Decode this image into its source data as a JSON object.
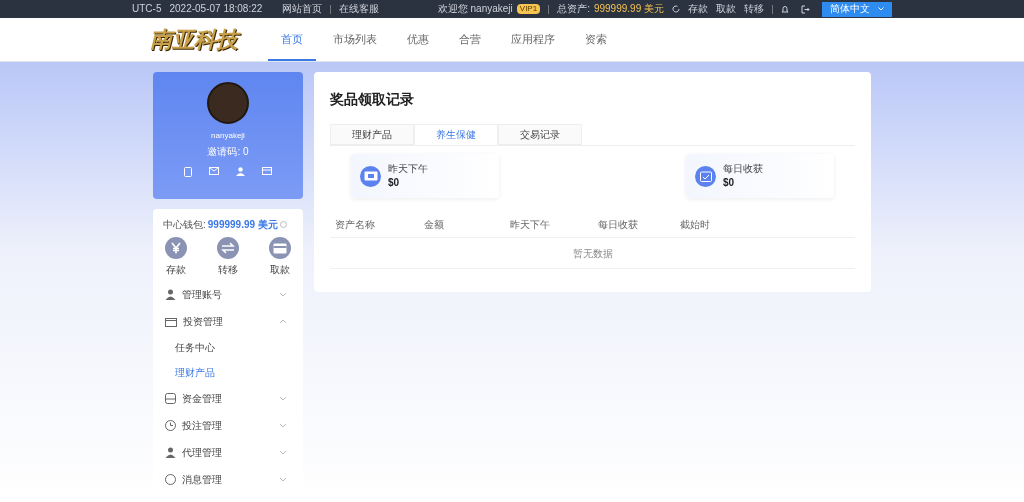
{
  "top_bar": {
    "timezone": "UTC-5",
    "datetime": "2022-05-07 18:08:22",
    "links": [
      "网站首页",
      "在线客服"
    ],
    "welcome": "欢迎您 nanyakeji",
    "vip": "VIP1",
    "assets_label": "总资产:",
    "assets_value": "999999.99 美元",
    "actions": [
      "存款",
      "取款",
      "转移"
    ],
    "language": "简体中文"
  },
  "header": {
    "logo": "南亚科技",
    "nav": [
      {
        "label": "首页",
        "selected": true
      },
      {
        "label": "市场列表",
        "selected": false
      },
      {
        "label": "优惠",
        "selected": false
      },
      {
        "label": "合营",
        "selected": false
      },
      {
        "label": "应用程序",
        "selected": false
      },
      {
        "label": "资索",
        "selected": false
      }
    ]
  },
  "profile": {
    "username": "nanyakeji",
    "invite_code": "邀请码: 0"
  },
  "wallet": {
    "label": "中心钱包:",
    "value": "999999.99 美元",
    "actions": [
      {
        "kind": "yen",
        "label": "存款"
      },
      {
        "kind": "transfer",
        "label": "转移"
      },
      {
        "kind": "card",
        "label": "取款"
      }
    ]
  },
  "menu": [
    {
      "kind": "user",
      "label": "管理账号",
      "expanded": false
    },
    {
      "kind": "folder",
      "label": "投资管理",
      "expanded": true,
      "children": [
        {
          "label": "任务中心",
          "selected": false
        },
        {
          "label": "理财产品",
          "selected": true
        }
      ]
    },
    {
      "kind": "money",
      "label": "资金管理",
      "expanded": false
    },
    {
      "kind": "bet",
      "label": "投注管理",
      "expanded": false
    },
    {
      "kind": "user",
      "label": "代理管理",
      "expanded": false
    },
    {
      "kind": "message",
      "label": "消息管理",
      "expanded": false
    }
  ],
  "main": {
    "title": "奖品领取记录",
    "tabs": [
      {
        "label": "理财产品",
        "selected": false
      },
      {
        "label": "养生保健",
        "selected": true
      },
      {
        "label": "交易记录",
        "selected": false
      }
    ],
    "stats": [
      {
        "kind": "ticket",
        "label": "昨天下午",
        "value": "$0"
      },
      {
        "kind": "calendar",
        "label": "每日收获",
        "value": "$0"
      }
    ],
    "table": {
      "columns": [
        "资产名称",
        "金额",
        "昨天下午",
        "每日收获",
        "截始时"
      ],
      "empty": "暂无数据"
    }
  }
}
